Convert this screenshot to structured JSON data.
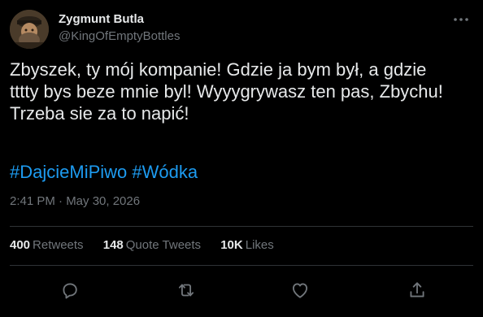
{
  "tweet": {
    "author": {
      "display_name": "Zygmunt Butla",
      "handle": "@KingOfEmptyBottles"
    },
    "text": "Zbyszek, ty mój kompanie! Gdzie ja bym był, a gdzie\ntttty bys beze mnie byl! Wyyygrywasz ten pas, Zbychu!\nTrzeba sie za to napić!",
    "hashtags": [
      "#DajcieMiPiwo",
      "#Wódka"
    ],
    "timestamp": "2:41 PM · May 30, 2026",
    "stats": {
      "retweets_count": "400",
      "retweets_label": "Retweets",
      "quotes_count": "148",
      "quotes_label": "Quote Tweets",
      "likes_count": "10K",
      "likes_label": "Likes"
    },
    "icons": {
      "more": "more-horizontal-icon",
      "reply": "reply-icon",
      "retweet": "retweet-icon",
      "like": "heart-icon",
      "share": "share-icon"
    }
  },
  "colors": {
    "background": "#000000",
    "text": "#e7e9ea",
    "secondary_text": "#71767b",
    "accent": "#1d9bf0",
    "divider": "#2f3336"
  }
}
